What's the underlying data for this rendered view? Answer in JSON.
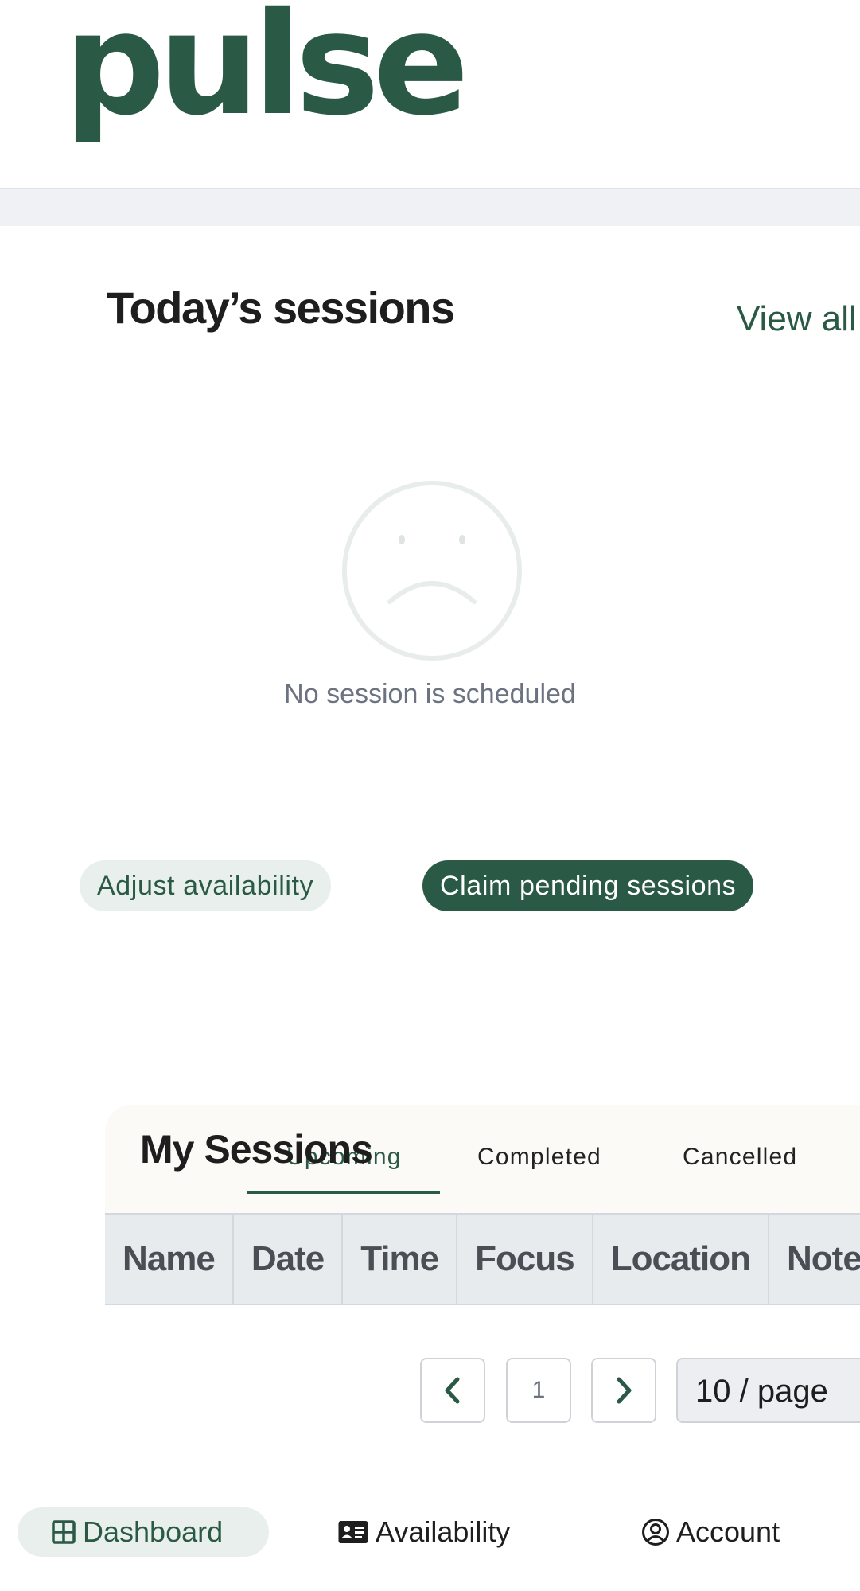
{
  "brand": {
    "logo_text": "pulse",
    "accent": "#2a5a45"
  },
  "today": {
    "title": "Today’s sessions",
    "view_all": "View all",
    "empty_icon": "sad-face-icon",
    "empty_text": "No session is scheduled"
  },
  "actions": {
    "adjust_availability": "Adjust availability",
    "claim_pending": "Claim pending sessions"
  },
  "sessions": {
    "title": "My Sessions",
    "tabs": [
      {
        "label": "Upcoming",
        "active": true
      },
      {
        "label": "Completed",
        "active": false
      },
      {
        "label": "Cancelled",
        "active": false
      }
    ],
    "columns": [
      "Name",
      "Date",
      "Time",
      "Focus",
      "Location",
      "Notes"
    ]
  },
  "pagination": {
    "current_page": "1",
    "page_size": "10 / page"
  },
  "bottom_nav": [
    {
      "label": "Dashboard",
      "icon": "grid-icon",
      "active": true
    },
    {
      "label": "Availability",
      "icon": "id-card-icon",
      "active": false
    },
    {
      "label": "Account",
      "icon": "user-circle-icon",
      "active": false
    }
  ]
}
